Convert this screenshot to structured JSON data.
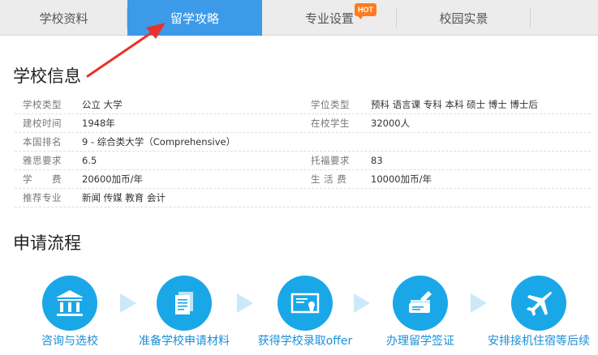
{
  "tabs": [
    {
      "label": "学校资料"
    },
    {
      "label": "留学攻略"
    },
    {
      "label": "专业设置",
      "badge": "HOT"
    },
    {
      "label": "校园实景"
    }
  ],
  "school_info": {
    "title": "学校信息",
    "rows": [
      {
        "label1": "学校类型",
        "value1": "公立 大学",
        "label2": "学位类型",
        "value2": "预科 语言课 专科 本科 硕士 博士 博士后"
      },
      {
        "label1": "建校时间",
        "value1": "1948年",
        "label2": "在校学生",
        "value2": "32000人"
      },
      {
        "label1": "本国排名",
        "value1": "9 - 综合类大学（Comprehensive）",
        "label2": "",
        "value2": ""
      },
      {
        "label1": "雅思要求",
        "value1": "6.5",
        "label2": "托福要求",
        "value2": "83"
      },
      {
        "label1": "学　　费",
        "value1": "20600加币/年",
        "label2": "生 活 费",
        "value2": "10000加币/年"
      },
      {
        "label1": "推荐专业",
        "value1": "新闻 传媒 教育 会计",
        "label2": "",
        "value2": ""
      }
    ]
  },
  "process": {
    "title": "申请流程",
    "steps": [
      {
        "label": "咨询与选校",
        "icon": "school-building-icon"
      },
      {
        "label": "准备学校申请材料",
        "icon": "document-icon"
      },
      {
        "label": "获得学校录取offer",
        "icon": "certificate-icon"
      },
      {
        "label": "办理留学签证",
        "icon": "passport-icon"
      },
      {
        "label": "安排接机住宿等后续",
        "icon": "airplane-icon"
      }
    ]
  },
  "colors": {
    "accent": "#3d9ae8",
    "hot": "#ff7b1c",
    "step": "#1aa7e8",
    "arrow": "#e8322b"
  }
}
